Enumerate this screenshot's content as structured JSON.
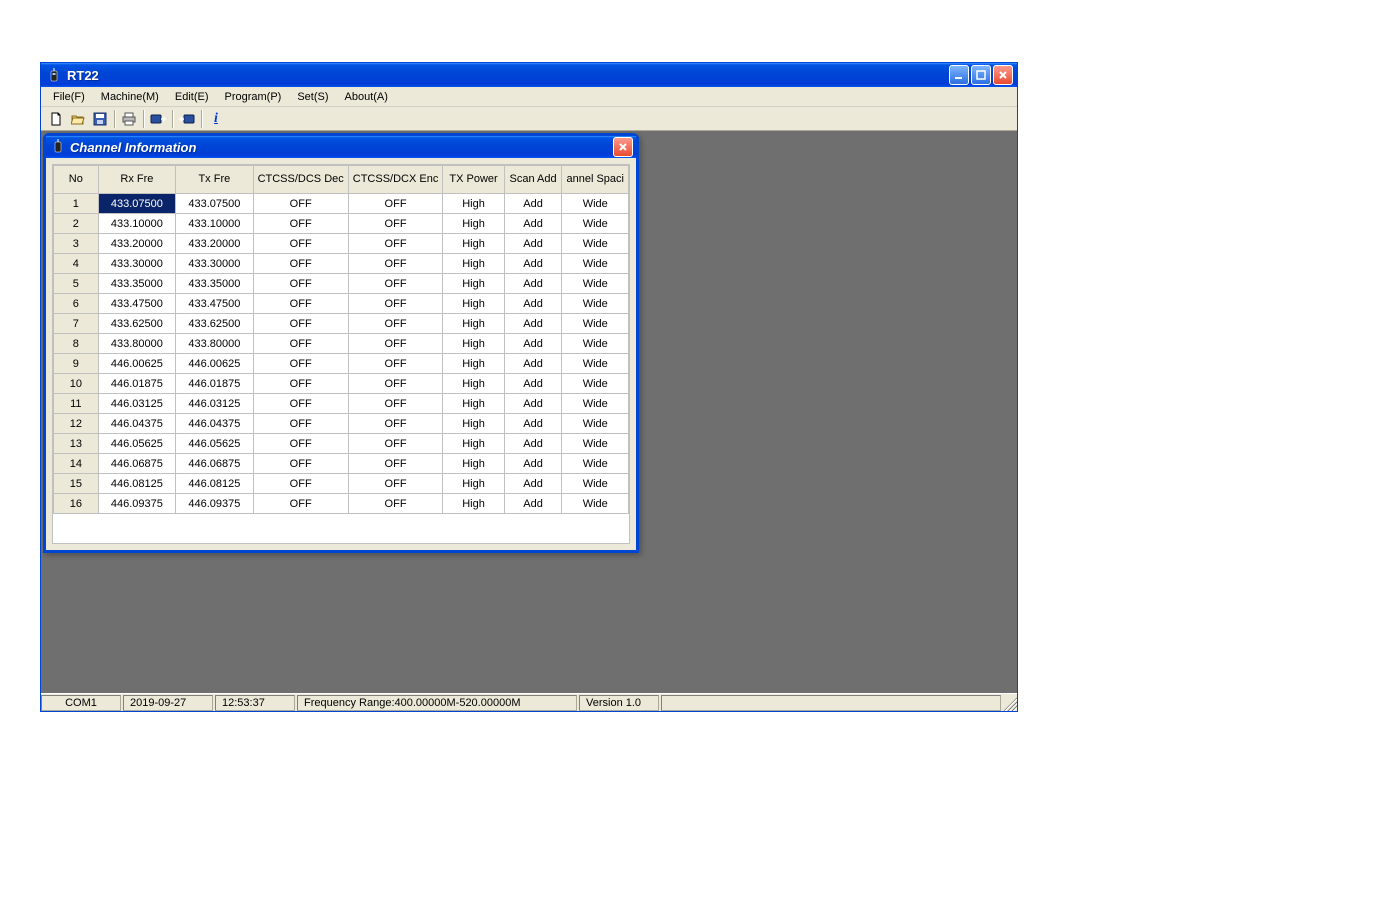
{
  "window": {
    "title": "RT22"
  },
  "menu": {
    "items": [
      "File(F)",
      "Machine(M)",
      "Edit(E)",
      "Program(P)",
      "Set(S)",
      "About(A)"
    ]
  },
  "toolbar": {
    "icons": [
      "new-file-icon",
      "open-folder-icon",
      "save-icon",
      "print-icon",
      "read-from-radio-icon",
      "write-to-radio-icon",
      "info-icon"
    ]
  },
  "child_window": {
    "title": "Channel Information"
  },
  "grid": {
    "headers": [
      "No",
      "Rx Fre",
      "Tx Fre",
      "CTCSS/DCS Dec",
      "CTCSS/DCX Enc",
      "TX Power",
      "Scan Add",
      "annel Spaci"
    ],
    "rows": [
      {
        "no": "1",
        "rx": "433.07500",
        "tx": "433.07500",
        "dec": "OFF",
        "enc": "OFF",
        "pwr": "High",
        "scan": "Add",
        "sp": "Wide",
        "sel": true
      },
      {
        "no": "2",
        "rx": "433.10000",
        "tx": "433.10000",
        "dec": "OFF",
        "enc": "OFF",
        "pwr": "High",
        "scan": "Add",
        "sp": "Wide"
      },
      {
        "no": "3",
        "rx": "433.20000",
        "tx": "433.20000",
        "dec": "OFF",
        "enc": "OFF",
        "pwr": "High",
        "scan": "Add",
        "sp": "Wide"
      },
      {
        "no": "4",
        "rx": "433.30000",
        "tx": "433.30000",
        "dec": "OFF",
        "enc": "OFF",
        "pwr": "High",
        "scan": "Add",
        "sp": "Wide"
      },
      {
        "no": "5",
        "rx": "433.35000",
        "tx": "433.35000",
        "dec": "OFF",
        "enc": "OFF",
        "pwr": "High",
        "scan": "Add",
        "sp": "Wide"
      },
      {
        "no": "6",
        "rx": "433.47500",
        "tx": "433.47500",
        "dec": "OFF",
        "enc": "OFF",
        "pwr": "High",
        "scan": "Add",
        "sp": "Wide"
      },
      {
        "no": "7",
        "rx": "433.62500",
        "tx": "433.62500",
        "dec": "OFF",
        "enc": "OFF",
        "pwr": "High",
        "scan": "Add",
        "sp": "Wide"
      },
      {
        "no": "8",
        "rx": "433.80000",
        "tx": "433.80000",
        "dec": "OFF",
        "enc": "OFF",
        "pwr": "High",
        "scan": "Add",
        "sp": "Wide"
      },
      {
        "no": "9",
        "rx": "446.00625",
        "tx": "446.00625",
        "dec": "OFF",
        "enc": "OFF",
        "pwr": "High",
        "scan": "Add",
        "sp": "Wide"
      },
      {
        "no": "10",
        "rx": "446.01875",
        "tx": "446.01875",
        "dec": "OFF",
        "enc": "OFF",
        "pwr": "High",
        "scan": "Add",
        "sp": "Wide"
      },
      {
        "no": "11",
        "rx": "446.03125",
        "tx": "446.03125",
        "dec": "OFF",
        "enc": "OFF",
        "pwr": "High",
        "scan": "Add",
        "sp": "Wide"
      },
      {
        "no": "12",
        "rx": "446.04375",
        "tx": "446.04375",
        "dec": "OFF",
        "enc": "OFF",
        "pwr": "High",
        "scan": "Add",
        "sp": "Wide"
      },
      {
        "no": "13",
        "rx": "446.05625",
        "tx": "446.05625",
        "dec": "OFF",
        "enc": "OFF",
        "pwr": "High",
        "scan": "Add",
        "sp": "Wide"
      },
      {
        "no": "14",
        "rx": "446.06875",
        "tx": "446.06875",
        "dec": "OFF",
        "enc": "OFF",
        "pwr": "High",
        "scan": "Add",
        "sp": "Wide"
      },
      {
        "no": "15",
        "rx": "446.08125",
        "tx": "446.08125",
        "dec": "OFF",
        "enc": "OFF",
        "pwr": "High",
        "scan": "Add",
        "sp": "Wide"
      },
      {
        "no": "16",
        "rx": "446.09375",
        "tx": "446.09375",
        "dec": "OFF",
        "enc": "OFF",
        "pwr": "High",
        "scan": "Add",
        "sp": "Wide"
      }
    ]
  },
  "status": {
    "com": "COM1",
    "date": "2019-09-27",
    "time": "12:53:37",
    "freq": "Frequency Range:400.00000M-520.00000M",
    "version": "Version 1.0"
  }
}
